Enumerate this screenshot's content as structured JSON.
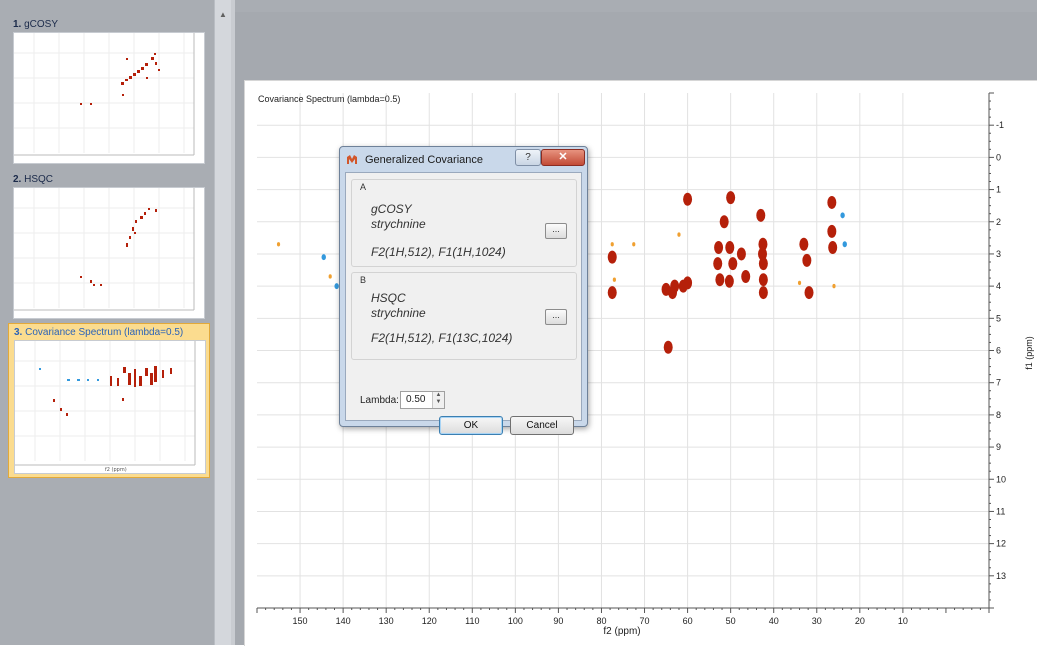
{
  "sidebar": {
    "thumbnails": [
      {
        "number": "1.",
        "label": "gCOSY"
      },
      {
        "number": "2.",
        "label": "HSQC"
      },
      {
        "number": "3.",
        "label": "Covariance Spectrum (lambda=0.5)"
      }
    ],
    "selected_index": 2
  },
  "spectrum": {
    "title": "Covariance Spectrum (lambda=0.5)",
    "x_axis_label": "f2 (ppm)",
    "y_axis_label": "f1 (ppm)",
    "x_ticks": [
      "150",
      "140",
      "130",
      "120",
      "110",
      "100",
      "90",
      "80",
      "70",
      "60",
      "50",
      "40",
      "30",
      "20",
      "10"
    ],
    "y_ticks": [
      "-1",
      "0",
      "1",
      "2",
      "3",
      "4",
      "5",
      "6",
      "7",
      "8",
      "9",
      "10",
      "11",
      "12",
      "13"
    ],
    "x_range": [
      160,
      -10
    ],
    "y_range": [
      -2,
      14
    ],
    "colors": {
      "positive": "#b5200a",
      "negative": "#3399dd",
      "weak": "#f0a030",
      "grid": "#e2e2e2"
    },
    "peaks_positive": [
      [
        64.5,
        5.9
      ],
      [
        61,
        4.0
      ],
      [
        63,
        4.0
      ],
      [
        63.5,
        4.2
      ],
      [
        65,
        4.1
      ],
      [
        60,
        1.3
      ],
      [
        60,
        3.9
      ],
      [
        52.8,
        2.8
      ],
      [
        52.5,
        3.8
      ],
      [
        53,
        3.3
      ],
      [
        50,
        1.25
      ],
      [
        50.3,
        3.85
      ],
      [
        50.2,
        2.8
      ],
      [
        49.5,
        3.3
      ],
      [
        51.5,
        2.0
      ],
      [
        47.5,
        3.0
      ],
      [
        46.5,
        3.7
      ],
      [
        43,
        1.8
      ],
      [
        42.5,
        2.7
      ],
      [
        42.6,
        3.0
      ],
      [
        42.4,
        3.3
      ],
      [
        42.4,
        3.8
      ],
      [
        42.4,
        4.2
      ],
      [
        33,
        2.7
      ],
      [
        32.3,
        3.2
      ],
      [
        31.8,
        4.2
      ],
      [
        26.5,
        1.4
      ],
      [
        26.5,
        2.3
      ],
      [
        26.3,
        2.8
      ],
      [
        77.5,
        3.1
      ],
      [
        77.5,
        4.2
      ]
    ],
    "peaks_negative": [
      [
        23.5,
        2.7
      ],
      [
        24,
        1.8
      ],
      [
        144.5,
        3.1
      ],
      [
        141.5,
        4.0
      ]
    ],
    "peaks_weak": [
      [
        26,
        4.0
      ],
      [
        34,
        3.9
      ],
      [
        77.5,
        2.7
      ],
      [
        72.5,
        2.7
      ],
      [
        77,
        3.8
      ],
      [
        143,
        3.7
      ],
      [
        155,
        2.7
      ],
      [
        62,
        2.4
      ]
    ]
  },
  "dialog": {
    "title": "Generalized Covariance",
    "help_label": "?",
    "close_label": "✕",
    "group_a": {
      "label": "A",
      "experiment": "gCOSY",
      "sample": "strychnine",
      "dimensions": "F2(1H,512), F1(1H,1024)",
      "browse_label": "..."
    },
    "group_b": {
      "label": "B",
      "experiment": "HSQC",
      "sample": "strychnine",
      "dimensions": "F2(1H,512), F1(13C,1024)",
      "browse_label": "..."
    },
    "lambda_label": "Lambda:",
    "lambda_value": "0.50",
    "ok_label": "OK",
    "cancel_label": "Cancel"
  },
  "icons": {
    "app_icon": "mnova-logo-icon",
    "scroll_up": "scroll-up-arrow-icon",
    "spin": "spin-updown-icon"
  }
}
